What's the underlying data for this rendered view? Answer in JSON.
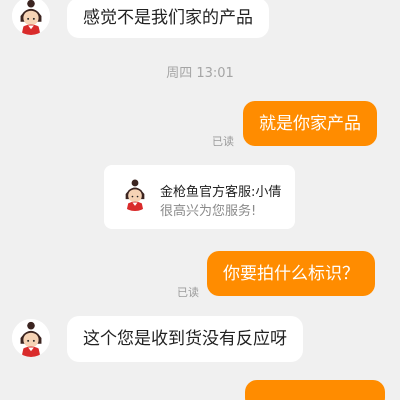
{
  "colors": {
    "background": "#f0f0f0",
    "outgoing_bubble": "#ff8c00",
    "incoming_bubble": "#ffffff",
    "read_status": "#9b9b9b",
    "timestamp": "#a5a5a5"
  },
  "messages": {
    "m1": {
      "text": "感觉不是我们家的产品",
      "sender": "agent"
    },
    "m2": {
      "text": "就是你家产品",
      "sender": "me",
      "status": "已读"
    },
    "m3": {
      "text": "你要拍什么标识？",
      "sender": "me",
      "status": "已读"
    },
    "m4": {
      "text": "这个您是收到货没有反应呀",
      "sender": "agent"
    }
  },
  "timestamp": "周四 13:01",
  "agent_card": {
    "title": "金枪鱼官方客服:小倩",
    "subtitle": "很高兴为您服务!"
  },
  "avatar_icon": "girl-avatar-icon"
}
